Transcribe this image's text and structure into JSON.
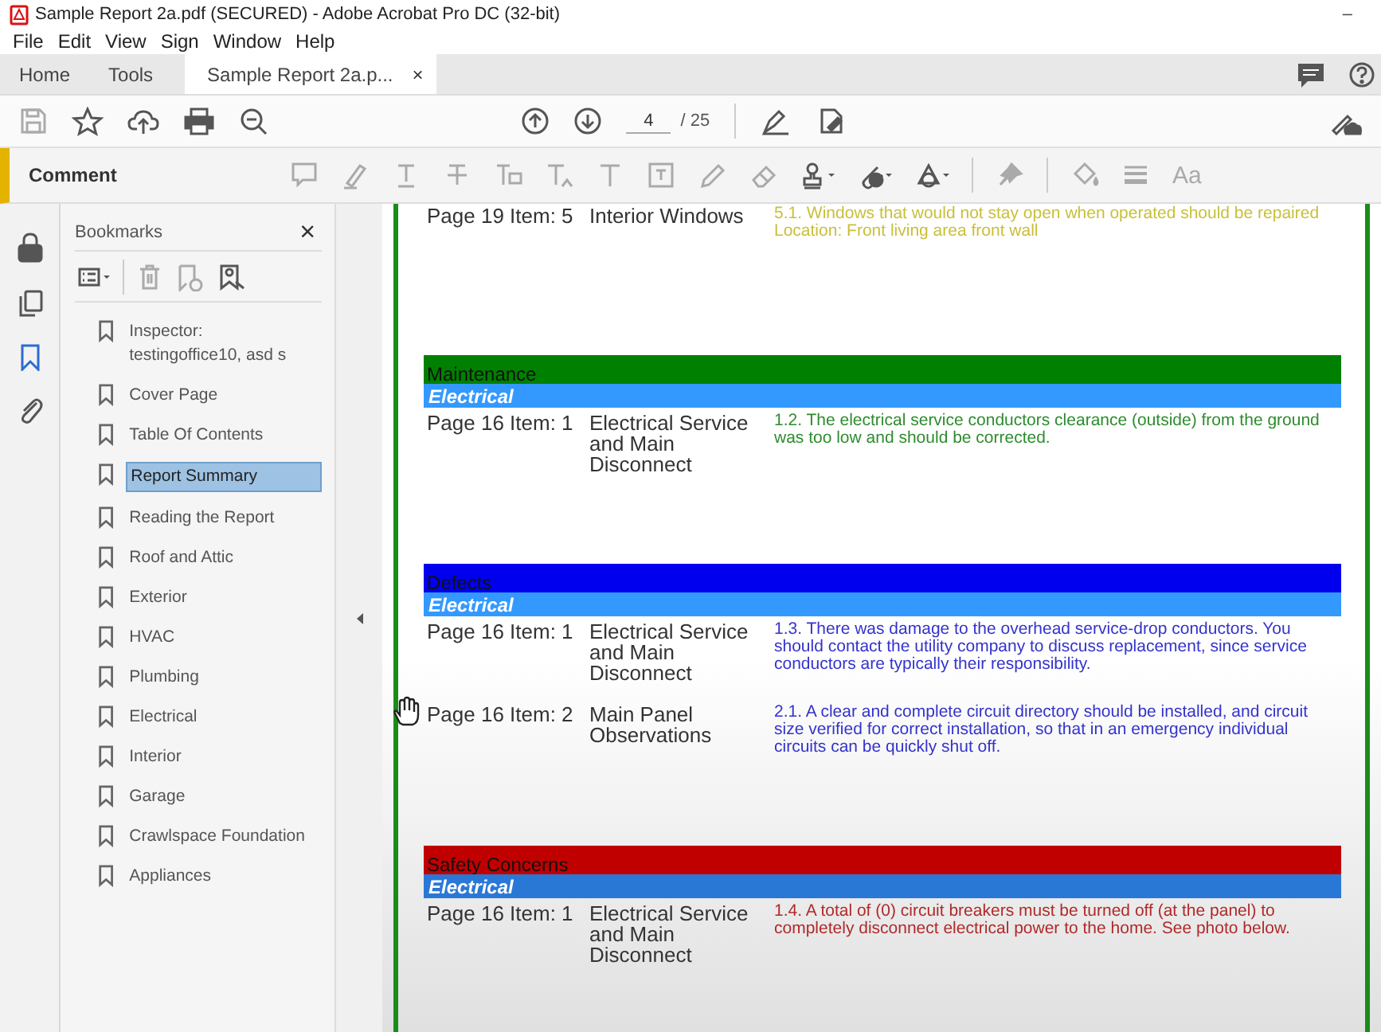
{
  "window": {
    "title": "Sample Report 2a.pdf (SECURED) - Adobe Acrobat Pro DC (32-bit)",
    "minimize": "–"
  },
  "menu": [
    "File",
    "Edit",
    "View",
    "Sign",
    "Window",
    "Help"
  ],
  "tabs": [
    {
      "label": "Home",
      "selected": false
    },
    {
      "label": "Tools",
      "selected": false
    },
    {
      "label": "Sample Report 2a.p...",
      "selected": true,
      "close": "×"
    }
  ],
  "toolbar": {
    "page_current": "4",
    "page_total": "/ 25"
  },
  "comment_bar": {
    "label": "Comment",
    "font_tool": "Aa"
  },
  "bookmarks_panel": {
    "title": "Bookmarks",
    "close": "×",
    "items": [
      {
        "label": "Inspector: testingoffice10, asd s",
        "selected": false
      },
      {
        "label": "Cover Page",
        "selected": false
      },
      {
        "label": "Table Of Contents",
        "selected": false
      },
      {
        "label": "Report Summary",
        "selected": true
      },
      {
        "label": "Reading the Report",
        "selected": false
      },
      {
        "label": "Roof and Attic",
        "selected": false
      },
      {
        "label": "Exterior",
        "selected": false
      },
      {
        "label": "HVAC",
        "selected": false
      },
      {
        "label": "Plumbing",
        "selected": false
      },
      {
        "label": "Electrical",
        "selected": false
      },
      {
        "label": "Interior",
        "selected": false
      },
      {
        "label": "Garage",
        "selected": false
      },
      {
        "label": "Crawlspace Foundation",
        "selected": false
      },
      {
        "label": "Appliances",
        "selected": false
      }
    ]
  },
  "document": {
    "sections": [
      {
        "kind": "monitor",
        "rows": [
          {
            "location": "Page 19 Item: 5",
            "component": "Interior Windows",
            "description": "5.1. Windows that would not stay open when operated should be repaired\nLocation: Front living area front wall"
          }
        ]
      },
      {
        "kind": "maintenance",
        "title": "Maintenance",
        "subtitle": "Electrical",
        "rows": [
          {
            "location": "Page 16 Item: 1",
            "component": "Electrical Service and Main Disconnect",
            "description": "1.2. The electrical service conductors clearance (outside) from the ground was too low and should be corrected."
          }
        ]
      },
      {
        "kind": "defect",
        "title": "Defects",
        "subtitle": "Electrical",
        "rows": [
          {
            "location": "Page 16 Item: 1",
            "component": "Electrical Service and Main Disconnect",
            "description": "1.3. There was damage to the overhead service-drop conductors. You should contact the utility company to discuss replacement, since service conductors are typically their responsibility."
          },
          {
            "location": "Page 16 Item: 2",
            "component": "Main Panel Observations",
            "description": "2.1. A clear and complete circuit directory should be installed, and circuit size verified for correct installation, so that in an emergency individual circuits can be quickly shut off.",
            "cursor": true
          }
        ]
      },
      {
        "kind": "safety",
        "title": "Safety Concerns",
        "subtitle": "Electrical",
        "rows": [
          {
            "location": "Page 16 Item: 1",
            "component": "Electrical Service and Main Disconnect",
            "description": "1.4. A total of (0) circuit breakers must be turned off (at the panel) to completely disconnect electrical power to the home. See photo below."
          }
        ]
      }
    ]
  }
}
